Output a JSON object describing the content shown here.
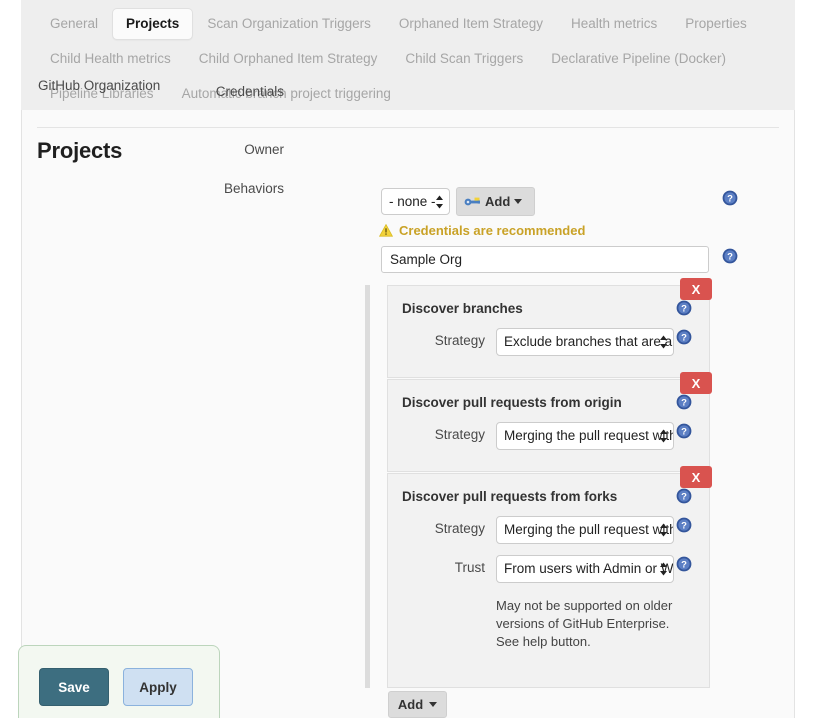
{
  "tabs": {
    "row1": [
      {
        "label": "General",
        "active": false
      },
      {
        "label": "Projects",
        "active": true
      },
      {
        "label": "Scan Organization Triggers",
        "active": false
      },
      {
        "label": "Orphaned Item Strategy",
        "active": false
      },
      {
        "label": "Health metrics",
        "active": false
      },
      {
        "label": "Properties",
        "active": false
      }
    ],
    "row2": [
      {
        "label": "Child Health metrics",
        "active": false
      },
      {
        "label": "Child Orphaned Item Strategy",
        "active": false
      },
      {
        "label": "Child Scan Triggers",
        "active": false
      },
      {
        "label": "Declarative Pipeline (Docker)",
        "active": false
      }
    ],
    "row3": [
      {
        "label": "Pipeline Libraries",
        "active": false
      },
      {
        "label": "Automatic branch project triggering",
        "active": false
      }
    ]
  },
  "page": {
    "title": "Projects",
    "section_label": "GitHub Organization"
  },
  "form": {
    "credentials": {
      "label": "Credentials",
      "selected": "- none -",
      "add_button": "Add",
      "warning": "Credentials are recommended"
    },
    "owner": {
      "label": "Owner",
      "value": "Sample Org",
      "placeholder": ""
    },
    "behaviors": {
      "label": "Behaviors",
      "add_button": "Add",
      "delete_label": "X",
      "items": [
        {
          "title": "Discover branches",
          "rows": [
            {
              "label": "Strategy",
              "value": "Exclude branches that are also filed as PRs"
            }
          ],
          "note": ""
        },
        {
          "title": "Discover pull requests from origin",
          "rows": [
            {
              "label": "Strategy",
              "value": "Merging the pull request with the current target branch revision"
            }
          ],
          "note": ""
        },
        {
          "title": "Discover pull requests from forks",
          "rows": [
            {
              "label": "Strategy",
              "value": "Merging the pull request with the current target branch revision"
            },
            {
              "label": "Trust",
              "value": "From users with Admin or Write permission"
            }
          ],
          "note": "May not be supported on older versions of GitHub Enterprise. See help button."
        }
      ]
    }
  },
  "footer": {
    "save_label": "Save",
    "apply_label": "Apply"
  },
  "colors": {
    "accent_save": "#3d6e80",
    "accent_apply": "#cfe0f2",
    "warning": "#c9a227",
    "danger": "#d9534f",
    "help_blue": "#33559b",
    "tab_bar_bg": "#eeeeee",
    "panel_bg": "#fafafa"
  },
  "icons": {
    "help": "help-icon",
    "warning": "warning-triangle-icon",
    "key": "key-icon",
    "caret": "chevron-down-icon",
    "spinner": "select-spinner-icon"
  }
}
